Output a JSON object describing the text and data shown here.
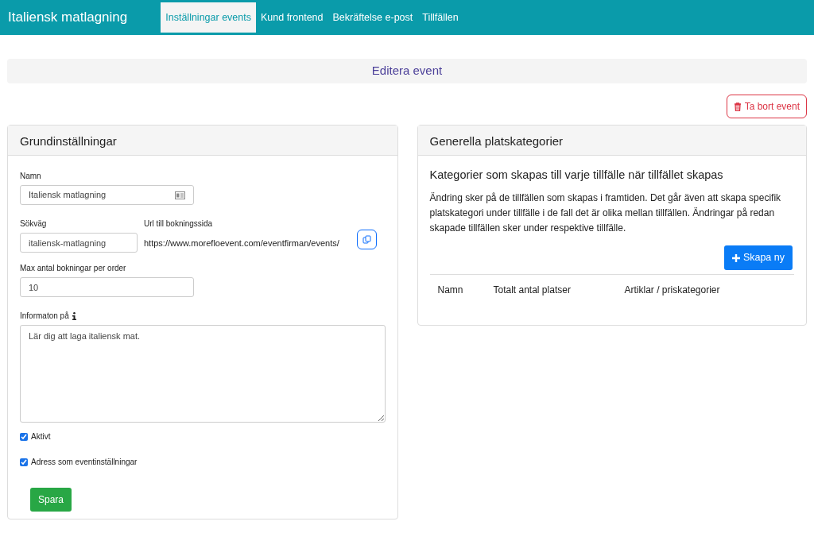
{
  "brand": "Italiensk matlagning",
  "nav": [
    {
      "label": "Inställningar events",
      "selected": true
    },
    {
      "label": "Kund frontend",
      "selected": false
    },
    {
      "label": "Bekräftelse e-post",
      "selected": false
    },
    {
      "label": "Tillfällen",
      "selected": false
    }
  ],
  "page_title": "Editera event",
  "delete_button": "Ta bort event",
  "basic": {
    "title": "Grundinställningar",
    "name": {
      "label": "Namn",
      "value": "Italiensk matlagning"
    },
    "path": {
      "label": "Sökväg",
      "value": "italiensk-matlagning"
    },
    "url": {
      "label": "Url till bokningssida",
      "value": "https://www.morefloevent.com/eventfirman/events/"
    },
    "max": {
      "label": "Max antal bokningar per order",
      "value": "10"
    },
    "info": {
      "label": "Informaton på",
      "value": "Lär dig att laga italiensk mat."
    },
    "checkboxes": [
      {
        "label": "Aktivt",
        "checked": true
      },
      {
        "label": "Adress som eventinställningar",
        "checked": true
      }
    ],
    "save": "Spara"
  },
  "categories": {
    "title": "Generella platskategorier",
    "heading": "Kategorier som skapas till varje tillfälle när tillfället skapas",
    "text": "Ändring sker på de tillfällen som skapas i framtiden. Det går även att skapa specifik platskategori under tillfälle i de fall det är olika mellan tillfällen. Ändringar på redan skapade tillfällen sker under respektive tillfälle.",
    "create_button": "Skapa ny",
    "columns": [
      "Namn",
      "Totalt antal platser",
      "Artiklar / priskategorier"
    ]
  }
}
